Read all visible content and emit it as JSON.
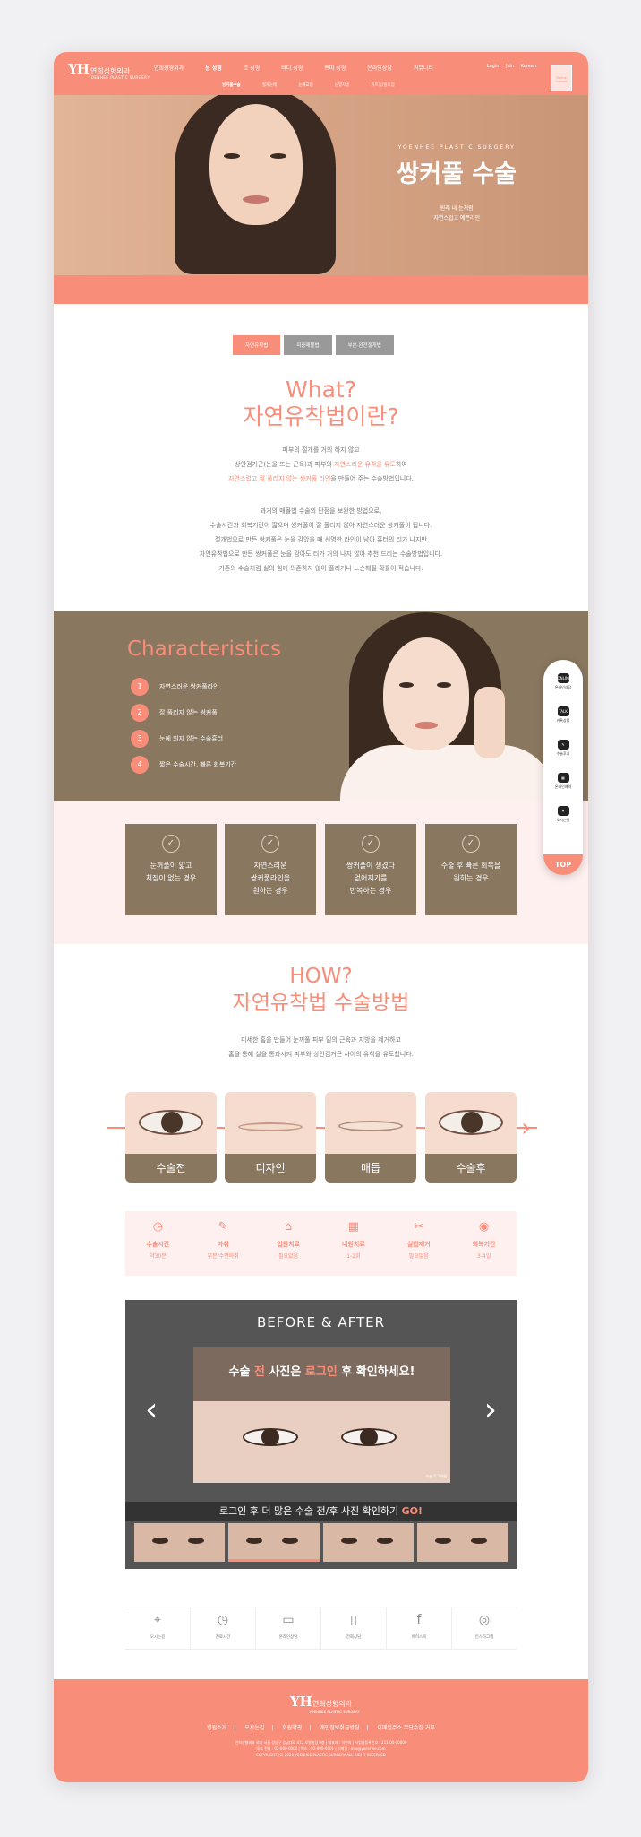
{
  "header": {
    "logo_mark": "YH",
    "logo_name": "연희성형외과",
    "logo_en": "YOENHEE PLASTIC SURGERY",
    "nav": [
      "연희성형외과",
      "눈 성형",
      "코 성형",
      "바디 성형",
      "쁘띠 성형",
      "온라인상담",
      "커뮤니티"
    ],
    "util": [
      "Login",
      "Join",
      "Korean"
    ],
    "consult_box": "Online Consult",
    "subnav": [
      "쌍커풀수술",
      "절개눈매",
      "눈매교정",
      "눈밑지방",
      "뒤트임/앞트임"
    ]
  },
  "hero": {
    "en": "YOENHEE PLASTIC SURGERY",
    "title": "쌍커풀 수술",
    "sub1": "원래 내 눈처럼",
    "sub2": "자연스럽고 예쁜라인"
  },
  "tabs": [
    "자연유착법",
    "미중매몰법",
    "부분·완전절개법"
  ],
  "what": {
    "h1": "What?",
    "h2": "자연유착법이란?",
    "p1a": "피부의 절개를 거의 하지 않고",
    "p1b_pre": "상안검거근(눈을 뜨는 근육)과 피부의 ",
    "p1b_em": "자연스러운 유착을 유도",
    "p1b_post": "하여",
    "p1c_em": "자연스럽고 잘 풀리지 않는 쌍커풀 라인",
    "p1c_post": "을 만들어 주는 수술방법입니다.",
    "p2": [
      "과거의 매몰법 수술의 단점을 보완한 방법으로,",
      "수술시간과 회복기간이 짧으며 쌍커풀이 잘 풀리지 않아 자연스러운 쌍커풀이 됩니다.",
      "절개법으로 만든 쌍커풀은 눈을 감았을 때 선명한 라인이 남아 흉터의 티가 나지만",
      "자연유착법으로 만든 쌍커풀은 눈을 감아도 티가 거의 나지 않아 추천 드리는 수술방법입니다.",
      "기존의 수술처럼 실의 힘에 의존하지 않아 풀리거나 느슨해질 확률이 적습니다."
    ]
  },
  "characteristics": {
    "title": "Characteristics",
    "items": [
      {
        "num": "1",
        "text": "자연스러운 쌍커풀라인"
      },
      {
        "num": "2",
        "text": "잘 풀리지 않는 쌍커풀"
      },
      {
        "num": "3",
        "text": "눈에 띄지 않는 수술흉터"
      },
      {
        "num": "4",
        "text": "짧은 수술시간, 빠른 회복기간"
      }
    ]
  },
  "boxes": [
    [
      "눈꺼풀이 얇고",
      "처짐이 없는 경우"
    ],
    [
      "자연스러운",
      "쌍커풀라인을",
      "원하는 경우"
    ],
    [
      "쌍커풀이 생겼다",
      "없어지기를",
      "반복하는 경우"
    ],
    [
      "수술 후 빠른 회복을",
      "원하는 경우"
    ]
  ],
  "how": {
    "h1": "HOW?",
    "h2": "자연유착법 수술방법",
    "p1": "미세한 홈을 만들어 눈꺼풀 피부 밑의 근육과 지방을 제거하고",
    "p2": "홈을 통해 실을 통과시켜 피부와 상안검거근 사이의 유착을 유도합니다.",
    "steps": [
      "수술전",
      "디자인",
      "매듭",
      "수술후"
    ]
  },
  "info": [
    {
      "icon": "clock-icon",
      "glyph": "◷",
      "name": "수술시간",
      "value": "약30분"
    },
    {
      "icon": "syringe-icon",
      "glyph": "✎",
      "name": "마취",
      "value": "부분/수면마취"
    },
    {
      "icon": "bed-icon",
      "glyph": "⌂",
      "name": "입원치료",
      "value": "필요없음"
    },
    {
      "icon": "calendar-icon",
      "glyph": "▦",
      "name": "내원치료",
      "value": "1-2회"
    },
    {
      "icon": "scissors-icon",
      "glyph": "✂",
      "name": "실밥제거",
      "value": "필요없음"
    },
    {
      "icon": "eye-icon",
      "glyph": "◉",
      "name": "회복기간",
      "value": "3-4일"
    }
  ],
  "before_after": {
    "title": "BEFORE & AFTER",
    "overlay_pre": "수술 ",
    "overlay_em1": "전",
    "overlay_mid": " 사진은 ",
    "overlay_em2": "로그인",
    "overlay_post": " 후 확인하세요!",
    "note": "수술 후 2개월",
    "login_text": "로그인 후 더 많은 수술 전/후 사진 확인하기 ",
    "login_go": "GO!"
  },
  "quick": [
    {
      "icon": "map-pin-icon",
      "glyph": "⌖",
      "label": "오시는길"
    },
    {
      "icon": "clock-icon",
      "glyph": "◷",
      "label": "진료시간"
    },
    {
      "icon": "monitor-icon",
      "glyph": "▭",
      "label": "온라인상담"
    },
    {
      "icon": "phone-icon",
      "glyph": "▯",
      "label": "전화상담"
    },
    {
      "icon": "facebook-icon",
      "glyph": "f",
      "label": "페이스북"
    },
    {
      "icon": "instagram-icon",
      "glyph": "◎",
      "label": "인스타그램"
    }
  ],
  "footer": {
    "logo_mark": "YH",
    "logo_name": "연희성형외과",
    "logo_en": "YOENHEE PLASTIC SURGERY",
    "links": [
      "병원소개",
      "오시는길",
      "회원약관",
      "개인정보취급방침",
      "이메일주소 무단수집 거부"
    ],
    "addr1": "연희성형외과 외과 서울 강남구 강남대로 412 로얄빌딩 9층 | 대표자 : 이연희 | 사업자등록번호 : 211-00-00000",
    "addr2": "대표 전화 : 02-000-0000 | 팩스 : 02-000-0001 | 이메일 : info@yoenhee.com",
    "copy": "COPYRIGHT (C) 2020 YOENHEE PLASTIC SURGERY ALL RIGHT RESERVED"
  },
  "side": [
    {
      "icon": "online-icon",
      "badge": "ONLINE",
      "label": "온라인상담"
    },
    {
      "icon": "talk-icon",
      "badge": "TALK",
      "label": "카톡상담"
    },
    {
      "icon": "review-icon",
      "badge": "✎",
      "label": "수술후기"
    },
    {
      "icon": "reserve-icon",
      "badge": "▦",
      "label": "온라인예약"
    },
    {
      "icon": "location-icon",
      "badge": "⌖",
      "label": "오시는길"
    }
  ],
  "top_label": "TOP",
  "colors": {
    "accent": "#f88d79",
    "olive": "#8a7760",
    "light_pink": "#fff0f0"
  }
}
